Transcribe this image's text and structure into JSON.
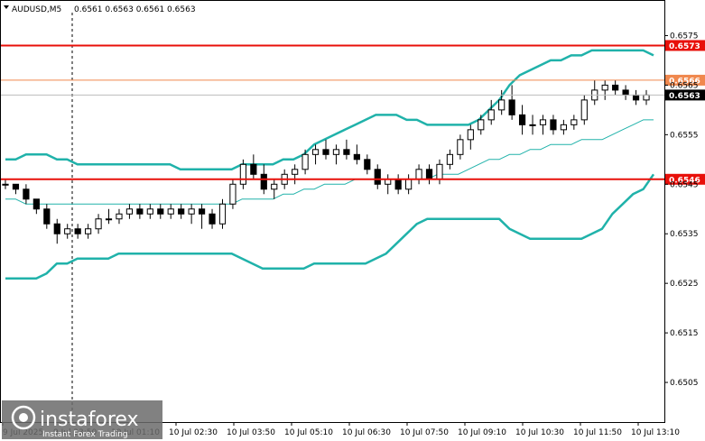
{
  "header": {
    "symbol": "AUDUSD,M5",
    "ohlc": "0.6561 0.6563 0.6561 0.6563"
  },
  "chart_data": {
    "type": "candlestick",
    "symbol": "AUDUSD",
    "timeframe": "M5",
    "ylim": [
      0.6497,
      0.6582
    ],
    "y_ticks": [
      "0.6575",
      "0.6565",
      "0.6555",
      "0.6545",
      "0.6535",
      "0.6525",
      "0.6515",
      "0.6505"
    ],
    "x_ticks": [
      "9 Jul 2025",
      "9 Jul 23:50",
      "10 Jul 01:10",
      "10 Jul 02:30",
      "10 Jul 03:50",
      "10 Jul 05:10",
      "10 Jul 06:30",
      "10 Jul 07:50",
      "10 Jul 09:10",
      "10 Jul 10:30",
      "10 Jul 11:50",
      "10 Jul 13:10"
    ],
    "horizontal_levels": [
      {
        "value": 0.6573,
        "label": "0.6573",
        "color": "#e8100a"
      },
      {
        "value": 0.6566,
        "label": "0.6566",
        "color": "#f0884e"
      },
      {
        "value": 0.6546,
        "label": "0.6546",
        "color": "#e8100a"
      }
    ],
    "current_price": {
      "value": 0.6563,
      "label": "0.6563"
    },
    "indicators": [
      {
        "name": "Bollinger upper",
        "color": "#20b2aa",
        "values": [
          0.655,
          0.655,
          0.6551,
          0.6551,
          0.6551,
          0.655,
          0.655,
          0.6549,
          0.6549,
          0.6549,
          0.6549,
          0.6549,
          0.6549,
          0.6549,
          0.6549,
          0.6549,
          0.6549,
          0.6548,
          0.6548,
          0.6548,
          0.6548,
          0.6548,
          0.6548,
          0.6549,
          0.6549,
          0.6549,
          0.6549,
          0.655,
          0.655,
          0.6551,
          0.6553,
          0.6554,
          0.6555,
          0.6556,
          0.6557,
          0.6558,
          0.6559,
          0.6559,
          0.6559,
          0.6558,
          0.6558,
          0.6557,
          0.6557,
          0.6557,
          0.6557,
          0.6557,
          0.6558,
          0.656,
          0.6562,
          0.6565,
          0.6567,
          0.6568,
          0.6569,
          0.657,
          0.657,
          0.6571,
          0.6571,
          0.6572,
          0.6572,
          0.6572,
          0.6572,
          0.6572,
          0.6572,
          0.6571
        ]
      },
      {
        "name": "Bollinger middle",
        "color": "#20b2aa",
        "values": [
          0.6542,
          0.6542,
          0.6541,
          0.6541,
          0.6541,
          0.6541,
          0.6541,
          0.6541,
          0.6541,
          0.6541,
          0.6541,
          0.6541,
          0.6541,
          0.6541,
          0.6541,
          0.6541,
          0.6541,
          0.6541,
          0.6541,
          0.6541,
          0.6541,
          0.6541,
          0.6541,
          0.6542,
          0.6542,
          0.6542,
          0.6542,
          0.6543,
          0.6543,
          0.6544,
          0.6544,
          0.6545,
          0.6545,
          0.6545,
          0.6546,
          0.6546,
          0.6546,
          0.6546,
          0.6546,
          0.6546,
          0.6546,
          0.6546,
          0.6547,
          0.6547,
          0.6547,
          0.6548,
          0.6549,
          0.655,
          0.655,
          0.6551,
          0.6551,
          0.6552,
          0.6552,
          0.6553,
          0.6553,
          0.6553,
          0.6554,
          0.6554,
          0.6554,
          0.6555,
          0.6556,
          0.6557,
          0.6558,
          0.6558
        ]
      },
      {
        "name": "Bollinger lower",
        "color": "#20b2aa",
        "values": [
          0.6526,
          0.6526,
          0.6526,
          0.6526,
          0.6527,
          0.6529,
          0.6529,
          0.653,
          0.653,
          0.653,
          0.653,
          0.6531,
          0.6531,
          0.6531,
          0.6531,
          0.6531,
          0.6531,
          0.6531,
          0.6531,
          0.6531,
          0.6531,
          0.6531,
          0.6531,
          0.653,
          0.6529,
          0.6528,
          0.6528,
          0.6528,
          0.6528,
          0.6528,
          0.6529,
          0.6529,
          0.6529,
          0.6529,
          0.6529,
          0.6529,
          0.653,
          0.6531,
          0.6533,
          0.6535,
          0.6537,
          0.6538,
          0.6538,
          0.6538,
          0.6538,
          0.6538,
          0.6538,
          0.6538,
          0.6538,
          0.6536,
          0.6535,
          0.6534,
          0.6534,
          0.6534,
          0.6534,
          0.6534,
          0.6534,
          0.6535,
          0.6536,
          0.6539,
          0.6541,
          0.6543,
          0.6544,
          0.6547
        ]
      }
    ],
    "candles": [
      [
        0.6545,
        0.6546,
        0.6544,
        0.6545
      ],
      [
        0.6545,
        0.6545,
        0.6543,
        0.6544
      ],
      [
        0.6544,
        0.6545,
        0.6541,
        0.6542
      ],
      [
        0.6542,
        0.6542,
        0.6539,
        0.654
      ],
      [
        0.654,
        0.6541,
        0.6536,
        0.6537
      ],
      [
        0.6537,
        0.6538,
        0.6533,
        0.6535
      ],
      [
        0.6535,
        0.6537,
        0.6534,
        0.6536
      ],
      [
        0.6536,
        0.6537,
        0.6534,
        0.6535
      ],
      [
        0.6535,
        0.6537,
        0.6534,
        0.6536
      ],
      [
        0.6536,
        0.6539,
        0.6535,
        0.6538
      ],
      [
        0.6538,
        0.654,
        0.6537,
        0.6538
      ],
      [
        0.6538,
        0.654,
        0.6537,
        0.6539
      ],
      [
        0.6539,
        0.6541,
        0.6538,
        0.654
      ],
      [
        0.654,
        0.6541,
        0.6538,
        0.6539
      ],
      [
        0.6539,
        0.6541,
        0.6538,
        0.654
      ],
      [
        0.654,
        0.6541,
        0.6538,
        0.6539
      ],
      [
        0.6539,
        0.6541,
        0.6538,
        0.654
      ],
      [
        0.654,
        0.6541,
        0.6538,
        0.6539
      ],
      [
        0.6539,
        0.6541,
        0.6537,
        0.654
      ],
      [
        0.654,
        0.6541,
        0.6536,
        0.6539
      ],
      [
        0.6539,
        0.654,
        0.6536,
        0.6537
      ],
      [
        0.6537,
        0.6542,
        0.6536,
        0.6541
      ],
      [
        0.6541,
        0.6546,
        0.654,
        0.6545
      ],
      [
        0.6545,
        0.655,
        0.6544,
        0.6549
      ],
      [
        0.6549,
        0.6551,
        0.6546,
        0.6547
      ],
      [
        0.6547,
        0.6549,
        0.6543,
        0.6544
      ],
      [
        0.6544,
        0.6546,
        0.6542,
        0.6545
      ],
      [
        0.6545,
        0.6548,
        0.6544,
        0.6547
      ],
      [
        0.6547,
        0.6549,
        0.6545,
        0.6548
      ],
      [
        0.6548,
        0.6552,
        0.6547,
        0.6551
      ],
      [
        0.6551,
        0.6553,
        0.6549,
        0.6552
      ],
      [
        0.6552,
        0.6554,
        0.655,
        0.6551
      ],
      [
        0.6551,
        0.6553,
        0.6549,
        0.6552
      ],
      [
        0.6552,
        0.6554,
        0.655,
        0.6551
      ],
      [
        0.6551,
        0.6553,
        0.6549,
        0.655
      ],
      [
        0.655,
        0.6551,
        0.6547,
        0.6548
      ],
      [
        0.6548,
        0.6549,
        0.6544,
        0.6545
      ],
      [
        0.6545,
        0.6547,
        0.6543,
        0.6546
      ],
      [
        0.6546,
        0.6547,
        0.6543,
        0.6544
      ],
      [
        0.6544,
        0.6547,
        0.6543,
        0.6546
      ],
      [
        0.6546,
        0.6549,
        0.6545,
        0.6548
      ],
      [
        0.6548,
        0.6549,
        0.6545,
        0.6546
      ],
      [
        0.6546,
        0.655,
        0.6545,
        0.6549
      ],
      [
        0.6549,
        0.6552,
        0.6548,
        0.6551
      ],
      [
        0.6551,
        0.6555,
        0.655,
        0.6554
      ],
      [
        0.6554,
        0.6557,
        0.6552,
        0.6556
      ],
      [
        0.6556,
        0.6559,
        0.6555,
        0.6558
      ],
      [
        0.6558,
        0.6562,
        0.6557,
        0.656
      ],
      [
        0.656,
        0.6564,
        0.6559,
        0.6562
      ],
      [
        0.6562,
        0.6565,
        0.6558,
        0.6559
      ],
      [
        0.6559,
        0.6561,
        0.6555,
        0.6557
      ],
      [
        0.6557,
        0.6559,
        0.6555,
        0.6557
      ],
      [
        0.6557,
        0.6559,
        0.6555,
        0.6558
      ],
      [
        0.6558,
        0.6559,
        0.6555,
        0.6556
      ],
      [
        0.6556,
        0.6558,
        0.6555,
        0.6557
      ],
      [
        0.6557,
        0.6559,
        0.6556,
        0.6558
      ],
      [
        0.6558,
        0.6563,
        0.6557,
        0.6562
      ],
      [
        0.6562,
        0.6566,
        0.6561,
        0.6564
      ],
      [
        0.6564,
        0.6566,
        0.6562,
        0.6565
      ],
      [
        0.6565,
        0.6566,
        0.6563,
        0.6564
      ],
      [
        0.6564,
        0.6565,
        0.6562,
        0.6563
      ],
      [
        0.6563,
        0.6564,
        0.6561,
        0.6562
      ],
      [
        0.6562,
        0.6564,
        0.6561,
        0.6563
      ]
    ]
  },
  "watermark": {
    "brand": "instaforex",
    "tagline": "Instant Forex Trading"
  },
  "colors": {
    "candle": "#000000",
    "level_red": "#e8100a",
    "level_orange": "#f0884e",
    "bollinger": "#20b2aa",
    "current_tag": "#000000"
  }
}
